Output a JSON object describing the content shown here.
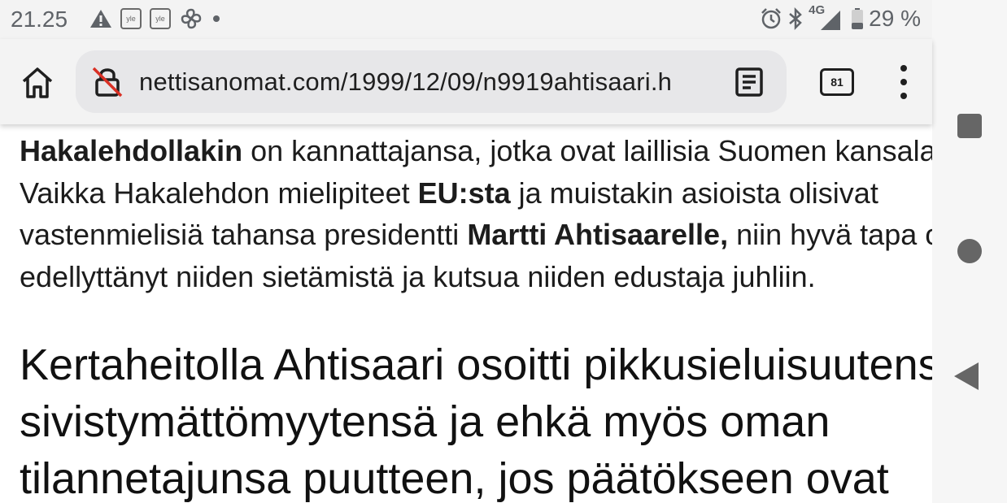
{
  "status_bar": {
    "time": "21.25",
    "network": "4G",
    "battery": "29 %",
    "icons": [
      "warning-icon",
      "yle-icon",
      "yle-icon",
      "fan-icon",
      "dot-icon",
      "alarm-icon",
      "bluetooth-icon",
      "signal-icon",
      "battery-icon"
    ],
    "yle_label": "yle"
  },
  "toolbar": {
    "url": "nettisanomat.com/1999/12/09/n9919ahtisaari.h",
    "tab_count": "81"
  },
  "article": {
    "lines": [
      {
        "b1": "Hakalehdollakin",
        "t1": " on kannattajansa, jotka ovat laillisia Suomen kansalaisia."
      },
      {
        "t1": "Vaikka Hakalehdon mielipiteet ",
        "b1": "EU:sta",
        "t2": " ja muistakin asioista olisivat"
      },
      {
        "t1": "vastenmielisiä tahansa presidentti ",
        "b1": "Martti Ahtisaarelle,",
        "t2": " niin hyvä tapa olisi"
      },
      {
        "t1": "edellyttänyt niiden sietämistä ja kutsua niiden edustaja juhliin."
      }
    ],
    "pull_quote": [
      "Kertaheitolla Ahtisaari osoitti pikkusieluisuutensa,",
      "sivistymättömyytensä ja ehkä myös oman",
      "tilannetajunsa puutteen, jos päätökseen ovat"
    ]
  },
  "colors": {
    "status_bg": "#f3f3f3",
    "url_bg": "#e7e7e9",
    "nav_bg": "#f6f6f6",
    "nav_icon": "#666666"
  }
}
